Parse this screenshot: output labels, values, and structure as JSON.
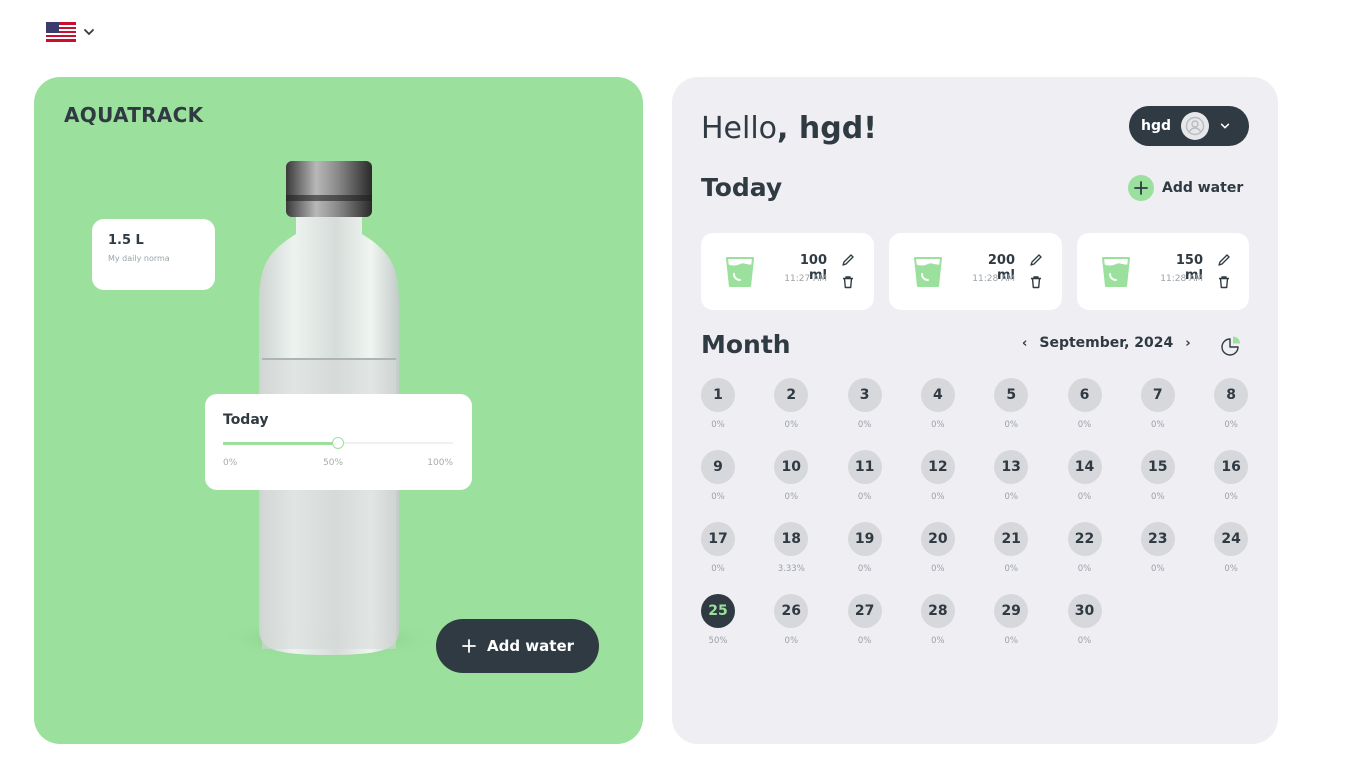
{
  "header": {
    "language_flag_icon": "us-flag-icon",
    "language_chevron_icon": "chevron-down-icon"
  },
  "left": {
    "logo": "AQUATRACK",
    "daily_norma": {
      "value": "1.5 L",
      "label": "My daily norma"
    },
    "today_progress": {
      "title": "Today",
      "percent": 50,
      "ticks": [
        "0%",
        "50%",
        "100%"
      ]
    },
    "add_water_button": "Add water",
    "accent_color": "#9be19d"
  },
  "right": {
    "greeting_prefix": "Hello",
    "greeting_name": ", hgd!",
    "user": {
      "name": "hgd"
    },
    "today_title": "Today",
    "add_water_link": "Add water",
    "entries": [
      {
        "volume": "100 ml",
        "time": "11:27 AM"
      },
      {
        "volume": "200 ml",
        "time": "11:28 AM"
      },
      {
        "volume": "150 ml",
        "time": "11:28 AM"
      }
    ],
    "month_title": "Month",
    "month_label": "September, 2024",
    "prev_arrow": "‹",
    "next_arrow": "›",
    "current_day": "25",
    "days": [
      {
        "d": "1",
        "p": "0%"
      },
      {
        "d": "2",
        "p": "0%"
      },
      {
        "d": "3",
        "p": "0%"
      },
      {
        "d": "4",
        "p": "0%"
      },
      {
        "d": "5",
        "p": "0%"
      },
      {
        "d": "6",
        "p": "0%"
      },
      {
        "d": "7",
        "p": "0%"
      },
      {
        "d": "8",
        "p": "0%"
      },
      {
        "d": "9",
        "p": "0%"
      },
      {
        "d": "10",
        "p": "0%"
      },
      {
        "d": "11",
        "p": "0%"
      },
      {
        "d": "12",
        "p": "0%"
      },
      {
        "d": "13",
        "p": "0%"
      },
      {
        "d": "14",
        "p": "0%"
      },
      {
        "d": "15",
        "p": "0%"
      },
      {
        "d": "16",
        "p": "0%"
      },
      {
        "d": "17",
        "p": "0%"
      },
      {
        "d": "18",
        "p": "3.33%"
      },
      {
        "d": "19",
        "p": "0%"
      },
      {
        "d": "20",
        "p": "0%"
      },
      {
        "d": "21",
        "p": "0%"
      },
      {
        "d": "22",
        "p": "0%"
      },
      {
        "d": "23",
        "p": "0%"
      },
      {
        "d": "24",
        "p": "0%"
      },
      {
        "d": "25",
        "p": "50%"
      },
      {
        "d": "26",
        "p": "0%"
      },
      {
        "d": "27",
        "p": "0%"
      },
      {
        "d": "28",
        "p": "0%"
      },
      {
        "d": "29",
        "p": "0%"
      },
      {
        "d": "30",
        "p": "0%"
      }
    ]
  }
}
